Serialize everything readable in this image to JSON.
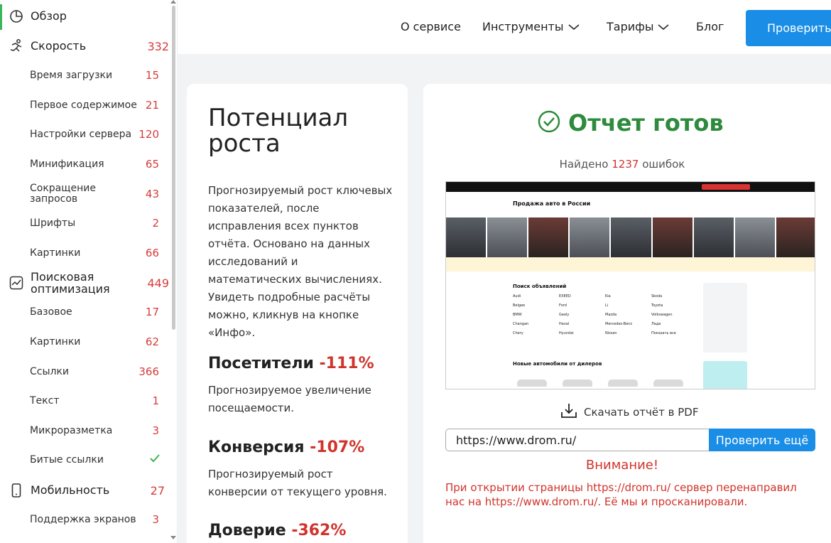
{
  "sidebar": {
    "items": [
      {
        "label": "Обзор",
        "count": "",
        "icon": "pie-chart-icon"
      },
      {
        "label": "Скорость",
        "count": "332",
        "icon": "runner-icon"
      },
      {
        "label": "Время загрузки",
        "count": "15"
      },
      {
        "label": "Первое содержимое",
        "count": "21"
      },
      {
        "label": "Настройки сервера",
        "count": "120"
      },
      {
        "label": "Минификация",
        "count": "65"
      },
      {
        "label": "Сокращение запросов",
        "count": "43"
      },
      {
        "label": "Шрифты",
        "count": "2"
      },
      {
        "label": "Картинки",
        "count": "66"
      },
      {
        "label": "Поисковая оптимизация",
        "count": "449",
        "icon": "trend-icon"
      },
      {
        "label": "Базовое",
        "count": "17"
      },
      {
        "label": "Картинки",
        "count": "62"
      },
      {
        "label": "Ссылки",
        "count": "366"
      },
      {
        "label": "Текст",
        "count": "1"
      },
      {
        "label": "Микроразметка",
        "count": "3"
      },
      {
        "label": "Битые ссылки",
        "count": "",
        "status": "ok"
      },
      {
        "label": "Мобильность",
        "count": "27",
        "icon": "mobile-icon"
      },
      {
        "label": "Поддержка экранов",
        "count": "3"
      }
    ],
    "colors": {
      "count": "#d73b3b",
      "ok": "#3cb55a",
      "active": "#3cb55a"
    }
  },
  "header": {
    "nav": [
      "О сервисе",
      "Инструменты",
      "Тарифы",
      "Блог"
    ],
    "check_button": "Проверить"
  },
  "potential": {
    "title": "Потенциал роста",
    "text": "Прогнозируемый рост ключевых показателей, после исправления всех пунктов отчёта. Основано на данных исследований и математических вычислениях. Увидеть подробные расчёты можно, кликнув на кнопке «Инфо».",
    "metrics": [
      {
        "name": "Посетители",
        "value": "-111%",
        "desc": "Прогнозируемое увеличение посещаемости."
      },
      {
        "name": "Конверсия",
        "value": "-107%",
        "desc": "Прогнозируемый рост конверсии от текущего уровня."
      },
      {
        "name": "Доверие",
        "value": "-362%",
        "desc": ""
      }
    ]
  },
  "report": {
    "ready_title": "Отчет готов",
    "found_prefix": "Найдено",
    "found_count": "1237",
    "found_suffix": "ошибок",
    "screenshot": {
      "site_title": "Продажа авто в России",
      "section_search": "Поиск объявлений",
      "section_new": "Новые автомобили от дилеров",
      "brands": [
        "Audi",
        "EXEED",
        "Kia",
        "Skoda",
        "Belgee",
        "Ford",
        "Li",
        "Toyota",
        "BMW",
        "Geely",
        "Mazda",
        "Volkswagen",
        "Changan",
        "Haval",
        "Mercedes-Benz",
        "Лада",
        "Chery",
        "Hyundai",
        "Nissan",
        "Показать все"
      ]
    },
    "download_label": "Скачать отчёт в PDF",
    "url_value": "https://www.drom.ru/",
    "again_button": "Проверить ещё",
    "warning_title": "Внимание!",
    "warning_text": "При открытии страницы https://drom.ru/ сервер перенаправил нас на https://www.drom.ru/. Её мы и просканировали."
  },
  "colors": {
    "accent_blue": "#1a8ee6",
    "success_green": "#2e8b3d",
    "error_red": "#d0342c"
  }
}
